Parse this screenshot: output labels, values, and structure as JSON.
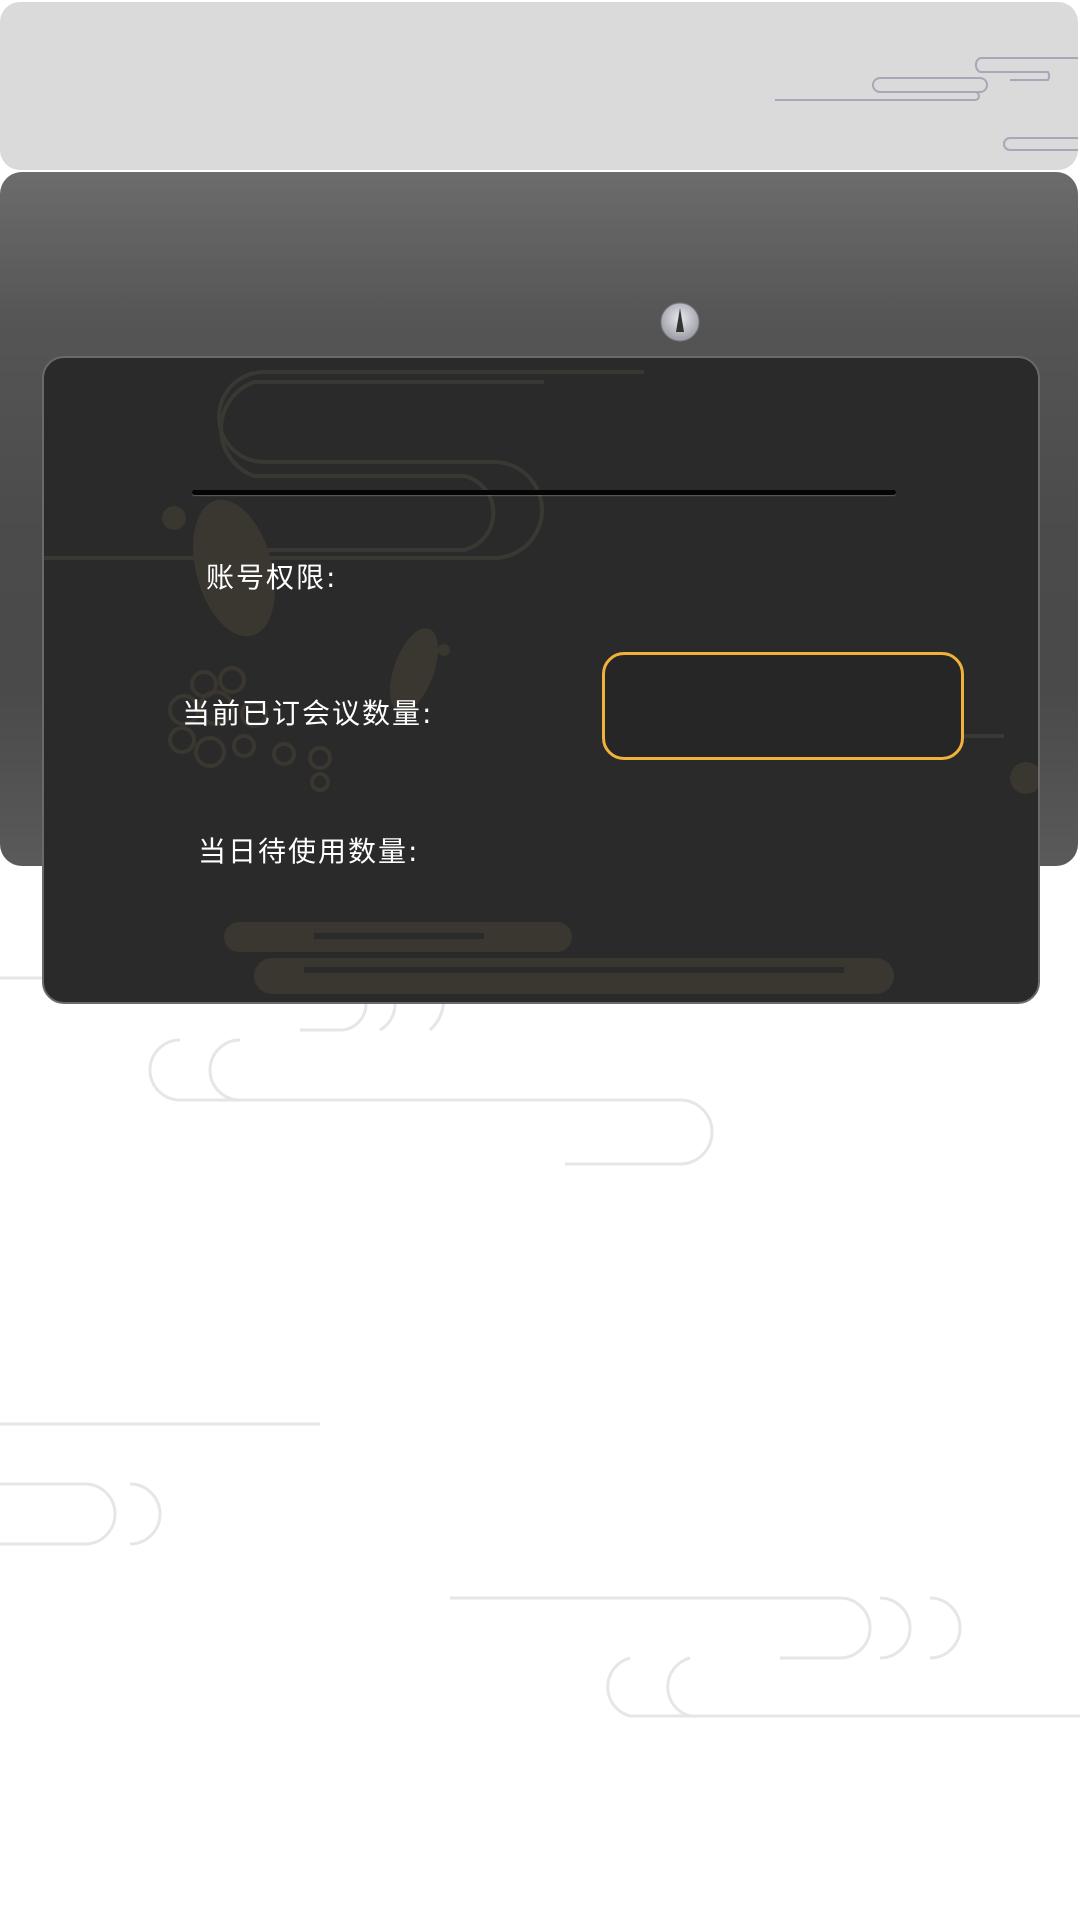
{
  "colors": {
    "banner": "#dadada",
    "header": "#4b4b4b",
    "card": "#2a2a2a",
    "accent": "#f0b23a",
    "label": "#ffffff"
  },
  "header": {
    "icon": "compass-icon"
  },
  "account_card": {
    "permission_label": "账号权限:",
    "permission_value": "",
    "booked_label": "当前已订会议数量:",
    "booked_value": "",
    "today_label": "当日待使用数量:",
    "today_value": ""
  }
}
